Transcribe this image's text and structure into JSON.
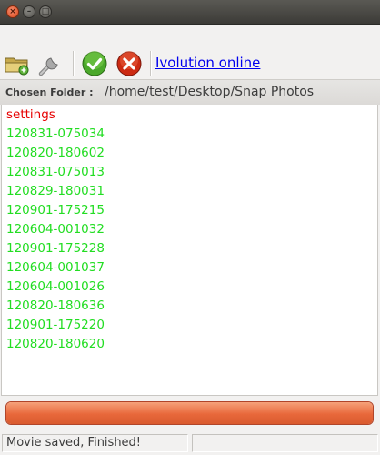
{
  "window": {
    "buttons": {
      "close_icon": "close-icon",
      "minimize_icon": "minimize-icon",
      "maximize_icon": "maximize-icon"
    }
  },
  "toolbar": {
    "open_icon": "folder-open-icon",
    "settings_icon": "wrench-icon",
    "ok_icon": "checkmark-icon",
    "cancel_icon": "cancel-x-icon",
    "link_label": "Ivolution online"
  },
  "folder": {
    "label": "Chosen Folder :",
    "path": "/home/test/Desktop/Snap Photos"
  },
  "list": {
    "items": [
      {
        "label": "settings",
        "color": "#e60000"
      },
      {
        "label": "120831-075034",
        "color": "#22dd22"
      },
      {
        "label": "120820-180602",
        "color": "#22dd22"
      },
      {
        "label": "120831-075013",
        "color": "#22dd22"
      },
      {
        "label": "120829-180031",
        "color": "#22dd22"
      },
      {
        "label": "120901-175215",
        "color": "#22dd22"
      },
      {
        "label": "120604-001032",
        "color": "#22dd22"
      },
      {
        "label": "120901-175228",
        "color": "#22dd22"
      },
      {
        "label": "120604-001037",
        "color": "#22dd22"
      },
      {
        "label": "120604-001026",
        "color": "#22dd22"
      },
      {
        "label": "120820-180636",
        "color": "#22dd22"
      },
      {
        "label": "120901-175220",
        "color": "#22dd22"
      },
      {
        "label": "120820-180620",
        "color": "#22dd22"
      }
    ]
  },
  "progress": {
    "fraction": 1.0,
    "color": "#e8683b"
  },
  "status": {
    "message": "Movie saved, Finished!",
    "secondary": ""
  }
}
